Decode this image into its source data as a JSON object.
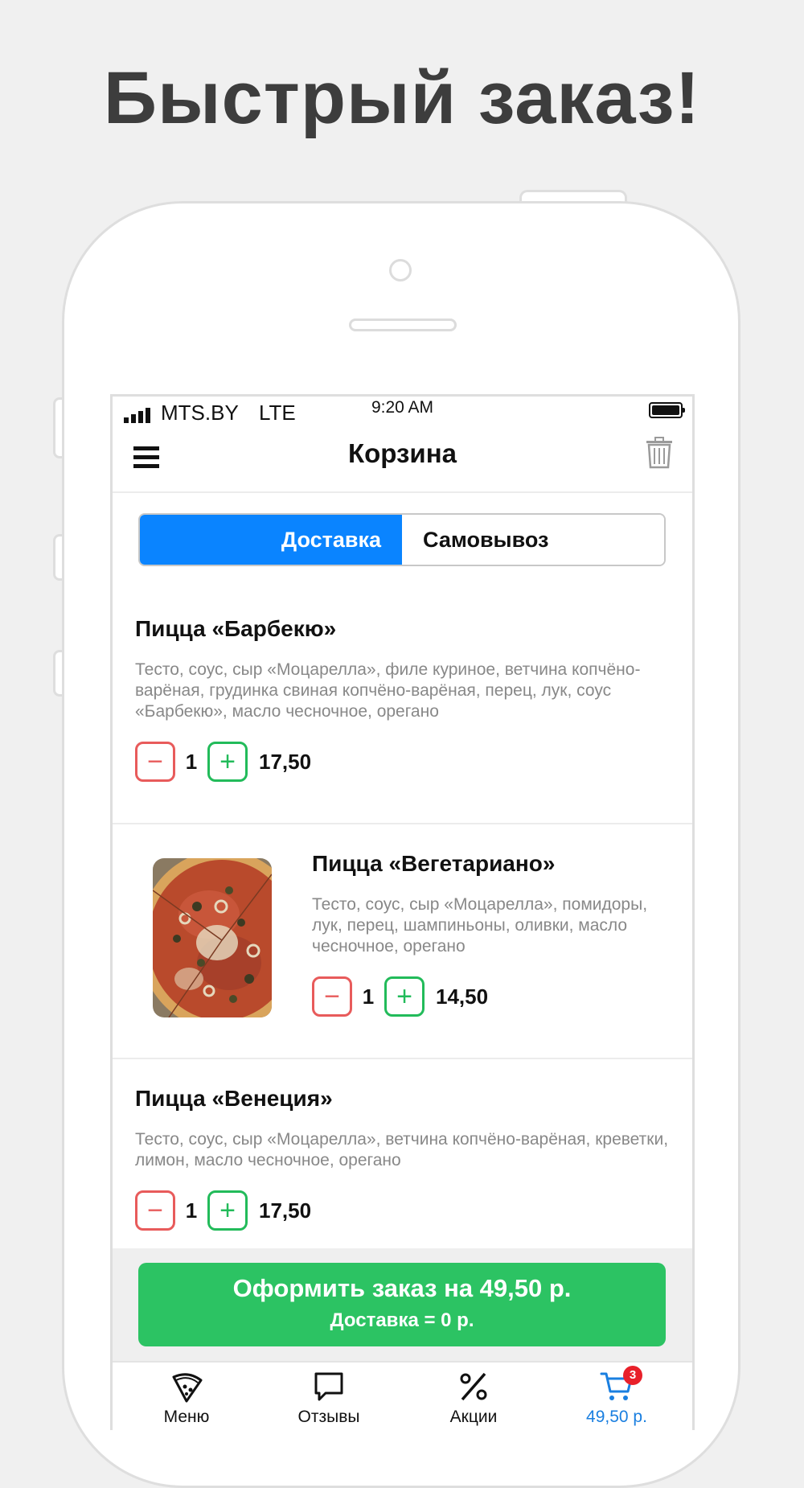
{
  "headline": "Быстрый заказ!",
  "status_bar": {
    "carrier": "MTS.BY",
    "network": "LTE",
    "time": "9:20 AM"
  },
  "nav": {
    "title": "Корзина"
  },
  "segment": {
    "active": "Доставка",
    "inactive": "Самовывоз"
  },
  "items": [
    {
      "title": "Пицца «Барбекю»",
      "description": "Тесто, соус, сыр «Моцарелла», филе куриное, ветчина копчёно-варёная, грудинка свиная копчёно-варёная, перец, лук, соус «Барбекю», масло чесночное, орегано",
      "quantity": "1",
      "price": "17,50"
    },
    {
      "title": "Пицца «Вегетариано»",
      "description": "Тесто, соус, сыр «Моцарелла», помидоры, лук, перец, шампиньоны, оливки, масло чесночное, орегано",
      "quantity": "1",
      "price": "14,50"
    },
    {
      "title": "Пицца «Венеция»",
      "description": "Тесто, соус, сыр «Моцарелла», ветчина копчёно-варёная, креветки, лимон, масло чесночное, орегано",
      "quantity": "1",
      "price": "17,50"
    }
  ],
  "checkout": {
    "line1": "Оформить заказ на 49,50 р.",
    "line2": "Доставка = 0 р."
  },
  "tabs": [
    {
      "label": "Меню",
      "icon": "pizza-slice-icon"
    },
    {
      "label": "Отзывы",
      "icon": "chat-bubble-icon"
    },
    {
      "label": "Акции",
      "icon": "percent-icon"
    },
    {
      "label": "49,50 р.",
      "icon": "cart-icon",
      "badge": "3"
    }
  ],
  "colors": {
    "accent_blue": "#0a84ff",
    "checkout_green": "#2cc363",
    "minus_red": "#e85b5b",
    "plus_green": "#22bb5a",
    "badge_red": "#e8202a"
  },
  "symbols": {
    "minus": "−",
    "plus": "+"
  }
}
